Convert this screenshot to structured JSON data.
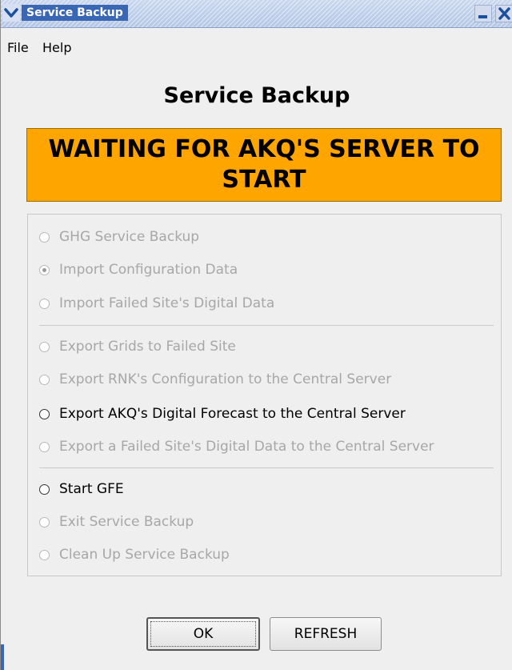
{
  "window": {
    "title": "Service Backup",
    "title_icon": "chevron-down-icon",
    "minimize_icon": "minimize-icon",
    "close_icon": "close-icon"
  },
  "menu": {
    "items": [
      "File",
      "Help"
    ]
  },
  "heading": "Service Backup",
  "status_banner": {
    "text": "WAITING FOR AKQ'S SERVER TO START",
    "color": "#ffa500"
  },
  "options": [
    {
      "label": "GHG Service Backup",
      "enabled": false,
      "selected": false
    },
    {
      "label": "Import Configuration Data",
      "enabled": false,
      "selected": true
    },
    {
      "label": "Import Failed Site's Digital Data",
      "enabled": false,
      "selected": false
    },
    {
      "label": "Export Grids to Failed Site",
      "enabled": false,
      "selected": false
    },
    {
      "label": "Export RNK's Configuration to the Central Server",
      "enabled": false,
      "selected": false
    },
    {
      "label": "Export AKQ's Digital Forecast to the Central Server",
      "enabled": true,
      "selected": false
    },
    {
      "label": "Export a Failed Site's Digital Data to the Central Server",
      "enabled": false,
      "selected": false
    },
    {
      "label": "Start GFE",
      "enabled": true,
      "selected": false
    },
    {
      "label": "Exit Service Backup",
      "enabled": false,
      "selected": false
    },
    {
      "label": "Clean Up Service Backup",
      "enabled": false,
      "selected": false
    }
  ],
  "buttons": {
    "ok": "OK",
    "refresh": "REFRESH"
  }
}
